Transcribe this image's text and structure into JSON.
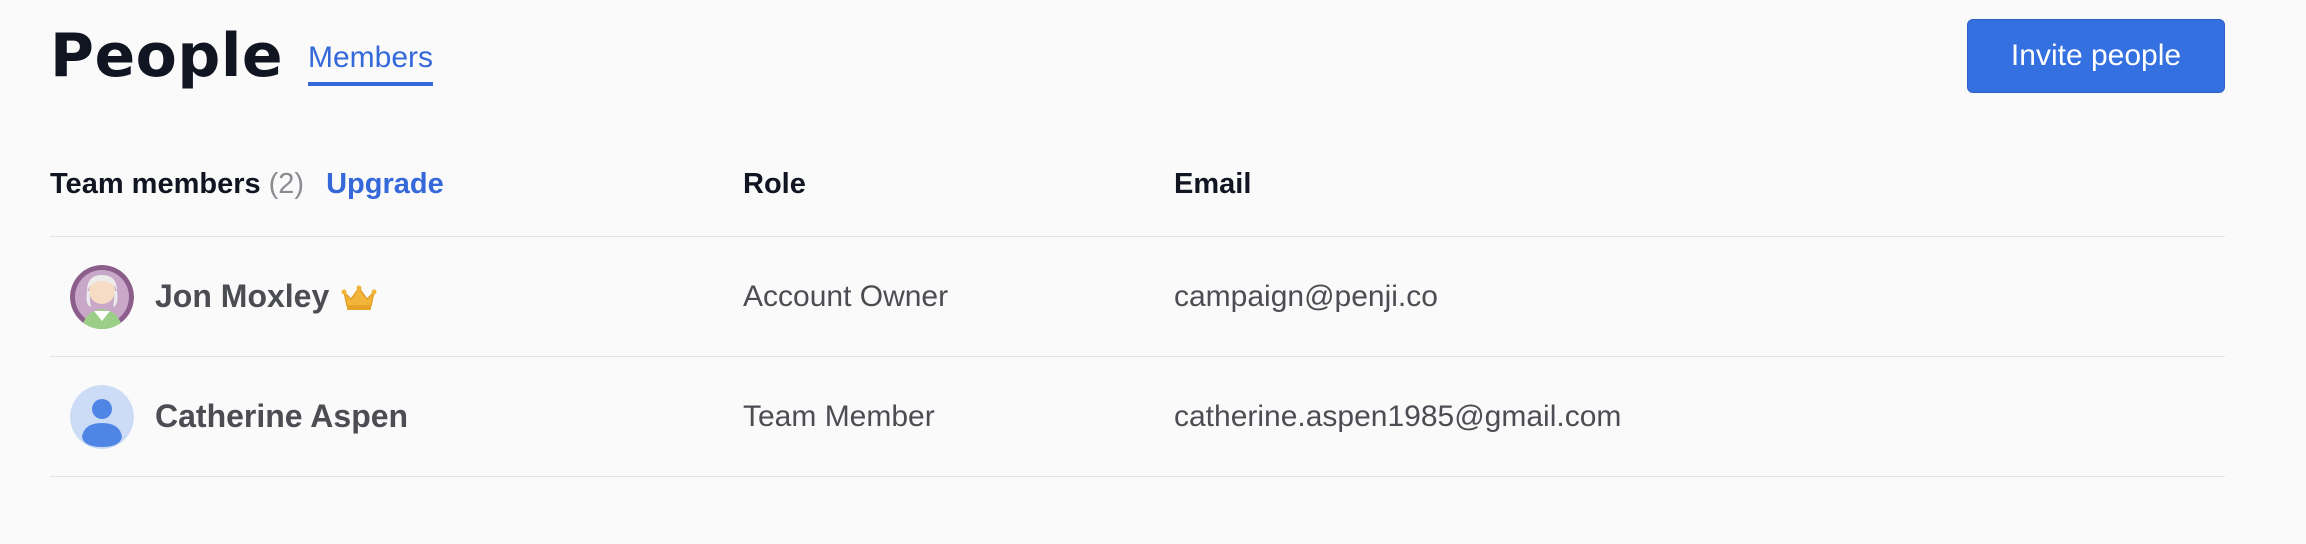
{
  "header": {
    "title": "People",
    "tab_members": "Members",
    "invite_button": "Invite people"
  },
  "table": {
    "col_team_members": "Team members",
    "member_count": "(2)",
    "upgrade_link": "Upgrade",
    "col_role": "Role",
    "col_email": "Email",
    "rows": [
      {
        "name": "Jon Moxley",
        "role": "Account Owner",
        "email": "campaign@penji.co",
        "badge_icon": "crown-icon"
      },
      {
        "name": "Catherine Aspen",
        "role": "Team Member",
        "email": "catherine.aspen1985@gmail.com",
        "badge_icon": ""
      }
    ]
  },
  "colors": {
    "accent": "#3470e0",
    "link": "#3569d9",
    "crown": "#f2b53a"
  }
}
